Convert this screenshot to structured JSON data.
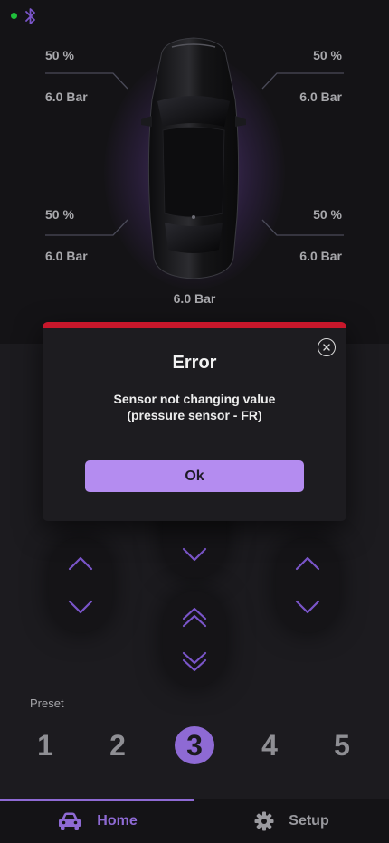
{
  "status": {
    "connection_color": "#1fbf3a",
    "bluetooth_icon": "bluetooth-icon"
  },
  "tires": {
    "front_left": {
      "percent": "50 %",
      "pressure": "6.0 Bar"
    },
    "front_right": {
      "percent": "50 %",
      "pressure": "6.0 Bar"
    },
    "rear_left": {
      "percent": "50 %",
      "pressure": "6.0 Bar"
    },
    "rear_right": {
      "percent": "50 %",
      "pressure": "6.0 Bar"
    },
    "center_pressure": "6.0 Bar"
  },
  "controls": {
    "left": {
      "up_icon": "chevron-up-icon",
      "down_icon": "chevron-down-icon"
    },
    "center": {
      "down_icon": "chevron-down-icon",
      "double_up_icon": "double-chevron-up-icon",
      "double_down_icon": "double-chevron-down-icon"
    },
    "right": {
      "up_icon": "chevron-up-icon",
      "down_icon": "chevron-down-icon"
    }
  },
  "preset": {
    "label": "Preset",
    "options": [
      "1",
      "2",
      "3",
      "4",
      "5"
    ],
    "selected": "3"
  },
  "nav": {
    "home": {
      "label": "Home",
      "icon": "car-icon"
    },
    "setup": {
      "label": "Setup",
      "icon": "gear-icon"
    },
    "active": "home"
  },
  "modal": {
    "title": "Error",
    "message_line1": "Sensor not changing value",
    "message_line2": "(pressure sensor - FR)",
    "ok_label": "Ok",
    "close_icon": "close-icon"
  },
  "colors": {
    "accent": "#8e6ad4",
    "error": "#c8172b",
    "button": "#b48cf0",
    "background": "#1c1b1f"
  }
}
